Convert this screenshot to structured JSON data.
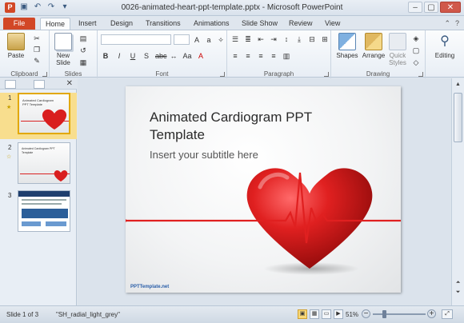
{
  "window": {
    "title": "0026-animated-heart-ppt-template.pptx - Microsoft PowerPoint",
    "app_badge": "P",
    "controls": [
      "–",
      "▢",
      "✕"
    ]
  },
  "qat": [
    "save-icon",
    "undo-icon",
    "redo-icon",
    "customize-icon"
  ],
  "tabs": {
    "file": "File",
    "items": [
      "Home",
      "Insert",
      "Design",
      "Transitions",
      "Animations",
      "Slide Show",
      "Review",
      "View"
    ],
    "active": "Home"
  },
  "ribbon": {
    "clipboard": {
      "label": "Clipboard",
      "paste": "Paste"
    },
    "slides": {
      "label": "Slides",
      "new_slide": "New Slide"
    },
    "font": {
      "label": "Font"
    },
    "paragraph": {
      "label": "Paragraph"
    },
    "drawing": {
      "label": "Drawing",
      "shapes": "Shapes",
      "arrange": "Arrange",
      "quick_styles": "Quick Styles"
    },
    "editing": {
      "label": "Editing"
    }
  },
  "thumbnails": [
    {
      "number": "1",
      "title": "Animated Cardiogram PPT Template"
    },
    {
      "number": "2",
      "title": "Animated Cardiogram PPT Template"
    },
    {
      "number": "3",
      "title": ""
    }
  ],
  "slide": {
    "title": "Animated Cardiogram PPT Template",
    "subtitle": "Insert your subtitle here",
    "brand": "PPTTemplate.net"
  },
  "status": {
    "slide_info": "Slide 1 of 3",
    "theme": "\"SH_radial_light_grey\"",
    "zoom": "51%"
  },
  "colors": {
    "file_tab": "#d24726",
    "heart": "#d91e1e",
    "ecg_line": "#e02020"
  }
}
